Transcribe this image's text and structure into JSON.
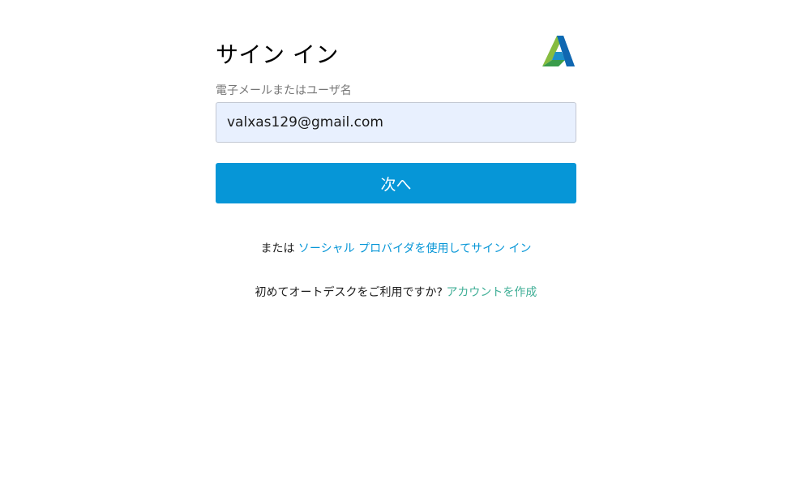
{
  "header": {
    "title": "サイン イン",
    "logo_icon": "autodesk-logo-icon"
  },
  "form": {
    "email_label": "電子メールまたはユーザ名",
    "email_value": "valxas129@gmail.com",
    "next_label": "次へ"
  },
  "alternatives": {
    "social_prefix": "または",
    "social_link": "ソーシャル プロバイダを使用してサイン イン",
    "create_prefix": "初めてオートデスクをご利用ですか?",
    "create_link": "アカウントを作成"
  },
  "colors": {
    "primary": "#0696d7",
    "input_background": "#e8f0fe",
    "create_link": "#3fae96"
  }
}
